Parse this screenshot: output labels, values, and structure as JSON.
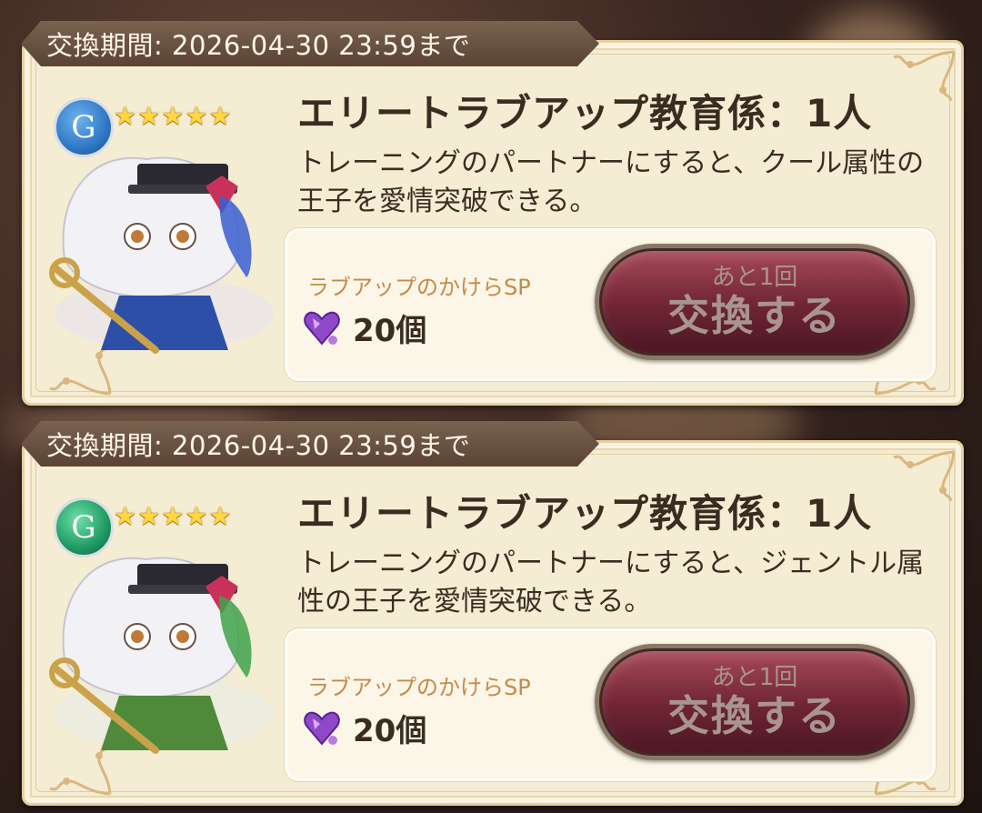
{
  "cards": [
    {
      "period": "交換期間: 2026-04-30 23:59まで",
      "attribute_letter": "G",
      "attribute_color": "#2f78c4",
      "ribbon_color": "#3a5fd0",
      "stars": "★★★★★",
      "title": "エリートラブアップ教育係：1人",
      "description": "トレーニングのパートナーにすると、クール属性の王子を愛情突破できる。",
      "cost_item": "ラブアップのかけらSP",
      "cost_count": "20個",
      "button_sub": "あと1回",
      "button_main": "交換する"
    },
    {
      "period": "交換期間: 2026-04-30 23:59まで",
      "attribute_letter": "G",
      "attribute_color": "#1f9a63",
      "ribbon_color": "#3fa34a",
      "stars": "★★★★★",
      "title": "エリートラブアップ教育係：1人",
      "description": "トレーニングのパートナーにすると、ジェントル属性の王子を愛情突破できる。",
      "cost_item": "ラブアップのかけらSP",
      "cost_count": "20個",
      "button_sub": "あと1回",
      "button_main": "交換する"
    }
  ]
}
